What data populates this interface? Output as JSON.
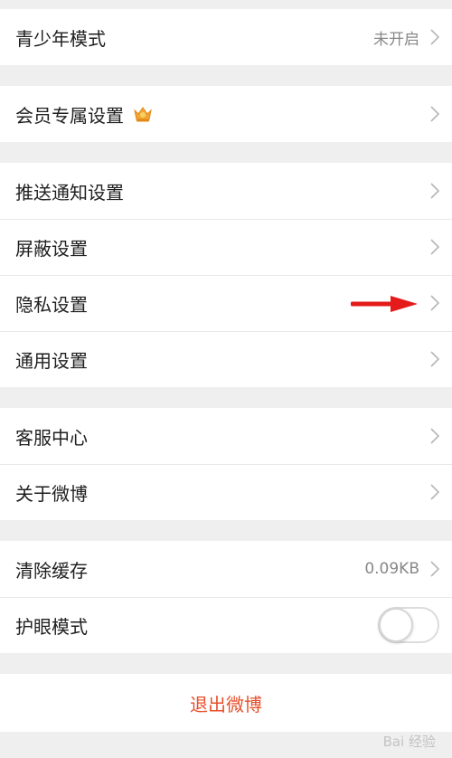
{
  "groups": {
    "youth": {
      "label": "青少年模式",
      "value": "未开启"
    },
    "vip": {
      "label": "会员专属设置"
    },
    "push": {
      "label": "推送通知设置"
    },
    "block": {
      "label": "屏蔽设置"
    },
    "privacy": {
      "label": "隐私设置"
    },
    "general": {
      "label": "通用设置"
    },
    "service": {
      "label": "客服中心"
    },
    "about": {
      "label": "关于微博"
    },
    "cache": {
      "label": "清除缓存",
      "value": "0.09KB"
    },
    "eyecare": {
      "label": "护眼模式",
      "enabled": false
    }
  },
  "logout_label": "退出微博",
  "watermark": "Bai 经验",
  "colors": {
    "accent": "#e8502c",
    "annotation_arrow": "#e51b1b"
  },
  "icons": {
    "chevron": "chevron-right-icon",
    "crown": "crown-icon"
  }
}
